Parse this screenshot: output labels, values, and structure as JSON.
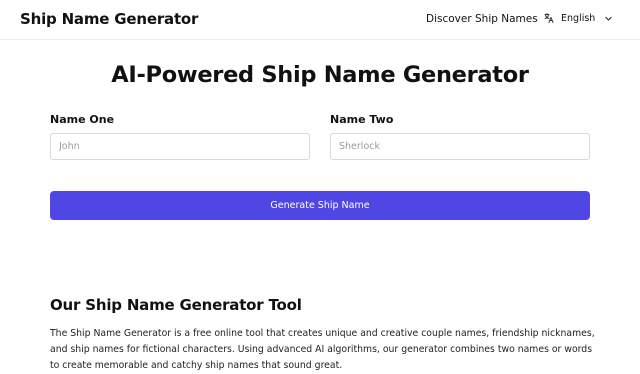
{
  "header": {
    "brand": "Ship Name Generator",
    "nav_link": "Discover Ship Names",
    "language": "English",
    "language_icon": "translate-icon",
    "dropdown_icon": "chevron-down-icon"
  },
  "main": {
    "title": "AI-Powered Ship Name Generator",
    "name_one": {
      "label": "Name One",
      "placeholder": "John",
      "value": ""
    },
    "name_two": {
      "label": "Name Two",
      "placeholder": "Sherlock",
      "value": ""
    },
    "generate_label": "Generate Ship Name"
  },
  "about": {
    "title": "Our Ship Name Generator Tool",
    "body": "The Ship Name Generator is a free online tool that creates unique and creative couple names, friendship nicknames, and ship names for fictional characters. Using advanced AI algorithms, our generator combines two names or words to create memorable and catchy ship names that sound great."
  },
  "colors": {
    "accent": "#5046e5",
    "border": "#d9d9d9",
    "text": "#111111",
    "placeholder": "#9a9a9a"
  }
}
